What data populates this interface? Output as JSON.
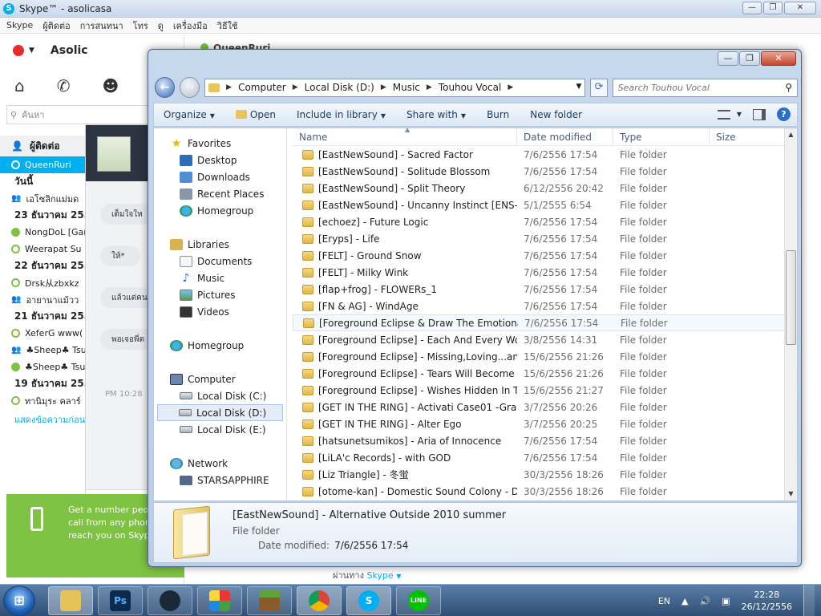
{
  "skype": {
    "title": "Skype™ - asolicasa",
    "menu": [
      "Skype",
      "ผู้ติดต่อ",
      "การสนทนา",
      "โทร",
      "ดู",
      "เครื่องมือ",
      "วิธีใช้"
    ],
    "user_name": "Asolic",
    "search_placeholder": "ค้นหา",
    "contacts_header": "ผู้ติดต่อ",
    "selected_contact": "QueenRuri",
    "peer_name": "QueenRuri",
    "rows": [
      {
        "kind": "day",
        "text": "วันนี้"
      },
      {
        "kind": "group",
        "text": "เอโซลิกแม่มด"
      },
      {
        "kind": "day",
        "text": "23 ธันวาคม 2556"
      },
      {
        "kind": "online",
        "text": "NongDoL [Gam"
      },
      {
        "kind": "away",
        "text": "Weerapat Su"
      },
      {
        "kind": "day",
        "text": "22 ธันวาคม 2556"
      },
      {
        "kind": "away",
        "text": "Drsk从zbxkz"
      },
      {
        "kind": "group",
        "text": "อายานาแม้วว"
      },
      {
        "kind": "day",
        "text": "21 ธันวาคม 2556"
      },
      {
        "kind": "away",
        "text": "XeferG www("
      },
      {
        "kind": "group",
        "text": "♣Sheep♣ Tsu"
      },
      {
        "kind": "online",
        "text": "♣Sheep♣ Tsu"
      },
      {
        "kind": "day",
        "text": "19 ธันวาคม 2556"
      },
      {
        "kind": "away",
        "text": "ทานิมุระ คลาร์"
      }
    ],
    "more_link": "แสดงข้อความก่อน",
    "promo": "Get a number people call from any phone reach you on Skype",
    "chat_bubbles": [
      "เต็มใจให",
      "ให้*",
      "แล้วแต่คน",
      "พอเจอพี่ต"
    ],
    "chat_time": "PM 10:28",
    "via_label": "ผ่านทาง",
    "via_value": "Skype"
  },
  "explorer": {
    "address": [
      "Computer",
      "Local Disk (D:)",
      "Music",
      "Touhou Vocal"
    ],
    "search_placeholder": "Search Touhou Vocal",
    "toolbar": {
      "organize": "Organize",
      "open": "Open",
      "include": "Include in library",
      "share": "Share with",
      "burn": "Burn",
      "new_folder": "New folder"
    },
    "nav": {
      "favorites": "Favorites",
      "desktop": "Desktop",
      "downloads": "Downloads",
      "recent": "Recent Places",
      "homegroup_fav": "Homegroup",
      "libraries": "Libraries",
      "documents": "Documents",
      "music": "Music",
      "pictures": "Pictures",
      "videos": "Videos",
      "homegroup": "Homegroup",
      "computer": "Computer",
      "disk_c": "Local Disk (C:)",
      "disk_d": "Local Disk (D:)",
      "disk_e": "Local Disk (E:)",
      "network": "Network",
      "starsapphire": "STARSAPPHIRE"
    },
    "columns": {
      "name": "Name",
      "date": "Date modified",
      "type": "Type",
      "size": "Size"
    },
    "files": [
      {
        "name": "[EastNewSound] - Sacred Factor",
        "date": "7/6/2556 17:54",
        "type": "File folder"
      },
      {
        "name": "[EastNewSound] - Solitude Blossom",
        "date": "7/6/2556 17:54",
        "type": "File folder"
      },
      {
        "name": "[EastNewSound] - Split Theory",
        "date": "6/12/2556 20:42",
        "type": "File folder"
      },
      {
        "name": "[EastNewSound] - Uncanny Instinct [ENS-00...",
        "date": "5/1/2555 6:54",
        "type": "File folder"
      },
      {
        "name": "[echoez] - Future Logic",
        "date": "7/6/2556 17:54",
        "type": "File folder"
      },
      {
        "name": "[Eryps] - Life",
        "date": "7/6/2556 17:54",
        "type": "File folder"
      },
      {
        "name": "[FELT] - Ground Snow",
        "date": "7/6/2556 17:54",
        "type": "File folder"
      },
      {
        "name": "[FELT] - Milky Wink",
        "date": "7/6/2556 17:54",
        "type": "File folder"
      },
      {
        "name": "[flap+frog] - FLOWERs_1",
        "date": "7/6/2556 17:54",
        "type": "File folder"
      },
      {
        "name": "[FN & AG] - WindAge",
        "date": "7/6/2556 17:54",
        "type": "File folder"
      },
      {
        "name": "[Foreground Eclipse & Draw The Emotional] ...",
        "date": "7/6/2556 17:54",
        "type": "File folder",
        "highlight": true
      },
      {
        "name": "[Foreground Eclipse] - Each And Every Word ...",
        "date": "3/8/2556 14:31",
        "type": "File folder"
      },
      {
        "name": "[Foreground Eclipse] - Missing,Loving...and ...",
        "date": "15/6/2556 21:26",
        "type": "File folder"
      },
      {
        "name": "[Foreground Eclipse] - Tears Will Become Me...",
        "date": "15/6/2556 21:26",
        "type": "File folder"
      },
      {
        "name": "[Foreground Eclipse] - Wishes Hidden In The...",
        "date": "15/6/2556 21:27",
        "type": "File folder"
      },
      {
        "name": "[GET IN THE RING] - Activati Case01 -Gravey...",
        "date": "3/7/2556 20:26",
        "type": "File folder"
      },
      {
        "name": "[GET IN THE RING] - Alter Ego",
        "date": "3/7/2556 20:25",
        "type": "File folder"
      },
      {
        "name": "[hatsunetsumikos] - Aria of Innocence",
        "date": "7/6/2556 17:54",
        "type": "File folder"
      },
      {
        "name": "[LiLA'c Records] - with GOD",
        "date": "7/6/2556 17:54",
        "type": "File folder"
      },
      {
        "name": "[Liz Triangle] - 冬蛍",
        "date": "30/3/2556 18:26",
        "type": "File folder"
      },
      {
        "name": "[otome-kan] - Domestic Sound Colony - Dis...",
        "date": "30/3/2556 18:26",
        "type": "File folder"
      }
    ],
    "details": {
      "name": "[EastNewSound] - Alternative Outside 2010 summer",
      "type": "File folder",
      "modified_label": "Date modified:",
      "modified_value": "7/6/2556 17:54"
    }
  },
  "taskbar": {
    "apps": [
      "explorer",
      "photoshop",
      "steam",
      "apps-grid",
      "minecraft",
      "chrome",
      "skype",
      "line"
    ],
    "ps_label": "Ps",
    "line_label": "LINE",
    "lang": "EN",
    "time": "22:28",
    "date": "26/12/2556"
  }
}
